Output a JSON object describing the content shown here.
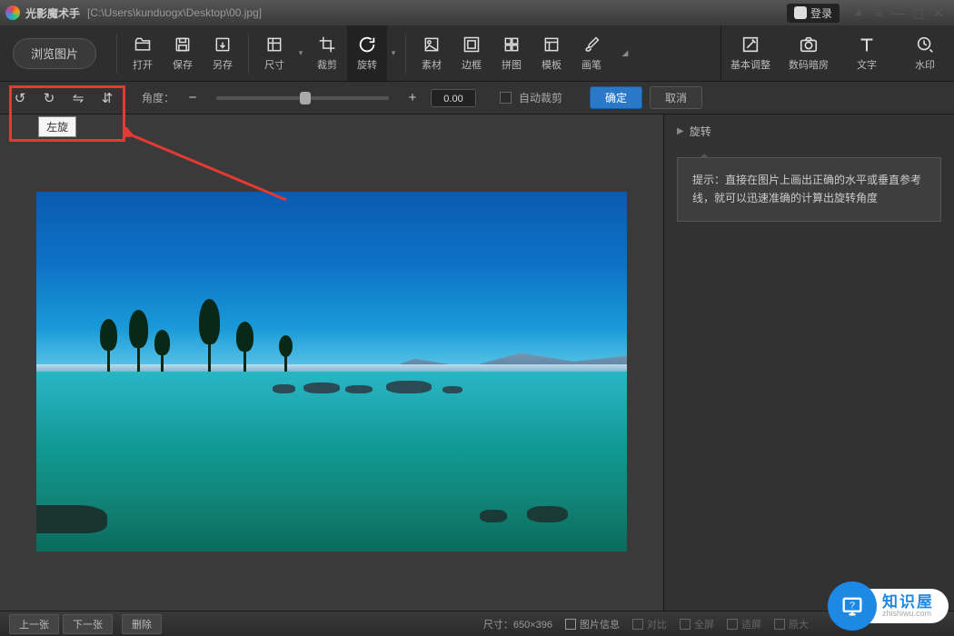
{
  "titlebar": {
    "app_name": "光影魔术手",
    "file_path": "[C:\\Users\\kunduogx\\Desktop\\00.jpg]",
    "login_label": "登录"
  },
  "toolbar": {
    "browse": "浏览图片",
    "items": [
      "打开",
      "保存",
      "另存"
    ],
    "items2": [
      "尺寸",
      "裁剪",
      "旋转"
    ],
    "items3": [
      "素材",
      "边框",
      "拼图",
      "模板",
      "画笔"
    ],
    "right": [
      "基本调整",
      "数码暗房",
      "文字",
      "水印"
    ],
    "active_index": 2
  },
  "subbar": {
    "angle_label": "角度：",
    "angle_value": "0.00",
    "auto_crop": "自动裁剪",
    "confirm": "确定",
    "cancel": "取消"
  },
  "panel": {
    "title": "旋转",
    "tip_label": "提示：",
    "tip_text": "直接在图片上画出正确的水平或垂直参考线，就可以迅速准确的计算出旋转角度"
  },
  "statusbar": {
    "prev": "上一张",
    "next": "下一张",
    "delete": "删除",
    "size_label": "尺寸：",
    "size_value": "650×396",
    "info": "图片信息",
    "compare": "对比",
    "fullscreen": "全屏",
    "fit": "适屏",
    "original": "原大"
  },
  "annotation": {
    "tooltip": "左旋"
  },
  "badge": {
    "text": "知识屋",
    "url": "zhishiwu.com"
  }
}
